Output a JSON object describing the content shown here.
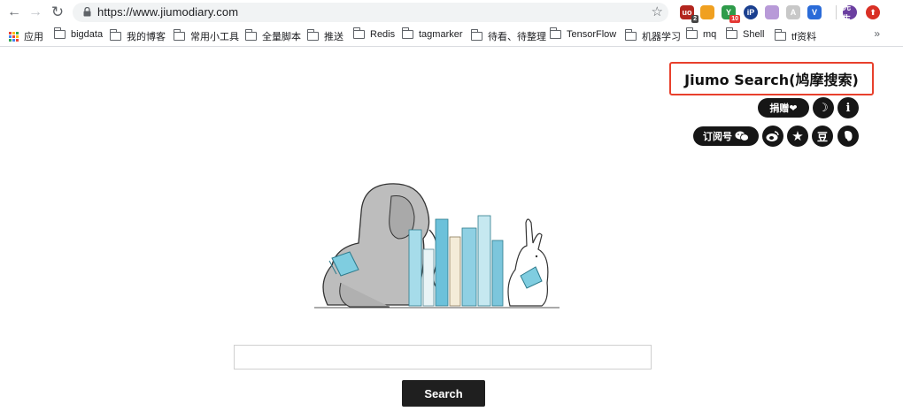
{
  "browser": {
    "url": "https://www.jiumodiary.com",
    "nav": {
      "back": "←",
      "forward": "→",
      "reload": "↻",
      "star": "☆"
    },
    "extensions": [
      {
        "name": "ublock-ext",
        "color": "#b3261e",
        "label": "uo",
        "badge": "2"
      },
      {
        "name": "shield-ext",
        "color": "#f0a020",
        "label": ""
      },
      {
        "name": "y-ext",
        "color": "#2e9b4a",
        "label": "Y",
        "badge": "10"
      },
      {
        "name": "ip-ext",
        "color": "#1a3f8f",
        "label": "iP"
      },
      {
        "name": "reader-ext",
        "color": "#b89ad8",
        "label": ""
      },
      {
        "name": "translate-ext",
        "color": "#c8c8c8",
        "label": "A"
      },
      {
        "name": "vue-ext",
        "color": "#2a6bd8",
        "label": "V"
      },
      {
        "name": "profile-ext",
        "color": "#6b3fa0",
        "label": "先生"
      },
      {
        "name": "download-ext",
        "color": "#d93025",
        "label": "⬆"
      }
    ]
  },
  "bookmarks": {
    "items": [
      {
        "label": "应用",
        "type": "apps"
      },
      {
        "label": "bigdata",
        "type": "folder"
      },
      {
        "label": "我的博客",
        "type": "folder"
      },
      {
        "label": "常用小工具",
        "type": "folder"
      },
      {
        "label": "全量脚本",
        "type": "folder"
      },
      {
        "label": "推送",
        "type": "folder"
      },
      {
        "label": "Redis",
        "type": "folder"
      },
      {
        "label": "tagmarker",
        "type": "folder"
      },
      {
        "label": "待看、待整理",
        "type": "folder"
      },
      {
        "label": "TensorFlow",
        "type": "folder"
      },
      {
        "label": "机器学习",
        "type": "folder"
      },
      {
        "label": "mq",
        "type": "folder"
      },
      {
        "label": "Shell",
        "type": "folder"
      },
      {
        "label": "tf资料",
        "type": "folder"
      }
    ],
    "more": "»"
  },
  "page": {
    "title": "Jiumo Search(鸠摩搜索)",
    "donate_label": "捐赠❤",
    "subscribe_label": "订阅号",
    "icons": {
      "moon": "☽",
      "info": "i",
      "star": "★",
      "douban": "豆"
    },
    "search_placeholder": "",
    "search_value": "",
    "search_button": "Search"
  }
}
